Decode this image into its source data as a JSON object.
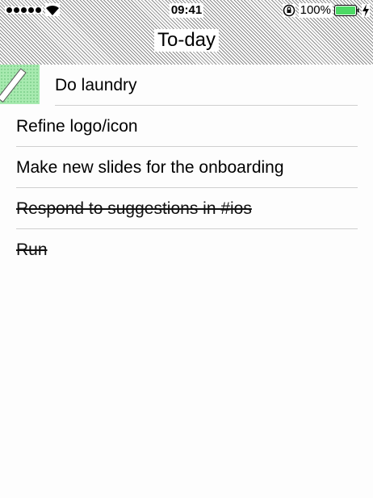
{
  "status_bar": {
    "time": "09:41",
    "battery_percent": "100%",
    "signal_dots": 5,
    "battery_level": 1.0
  },
  "nav": {
    "title": "To-day"
  },
  "todos": [
    {
      "label": "Do laundry",
      "done": false
    },
    {
      "label": "Refine logo/icon",
      "done": false
    },
    {
      "label": "Make new slides for the onboarding",
      "done": false
    },
    {
      "label": "Respond to suggestions in #ios",
      "done": true
    },
    {
      "label": "Run",
      "done": true
    }
  ],
  "colors": {
    "edit_handle": "#a8eab0",
    "battery": "#4cd964",
    "divider": "#cfcfcf"
  },
  "icons": {
    "signal": "cellular-signal-icon",
    "wifi": "wifi-icon",
    "lock": "rotation-lock-icon",
    "battery": "battery-icon",
    "charging": "charging-bolt-icon",
    "edit": "pencil-icon"
  }
}
